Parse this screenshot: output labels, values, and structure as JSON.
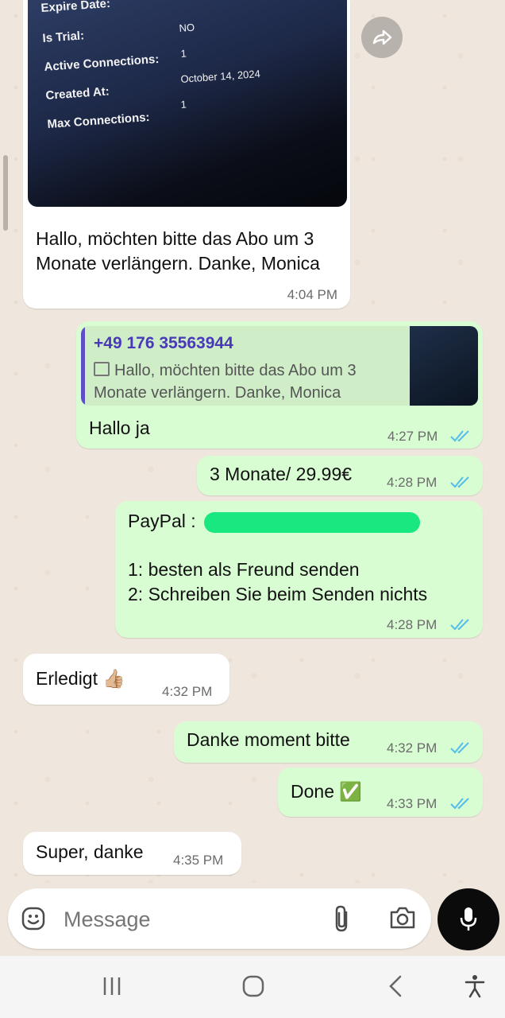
{
  "image_message": {
    "labels": [
      "Expire Date:",
      "Is Trial:",
      "Active Connections:",
      "Created At:",
      "Max Connections:"
    ],
    "values": [
      "NO",
      "1",
      "October 14, 2024",
      "1"
    ],
    "caption": "Hallo, möchten bitte das Abo um 3 Monate verlängern. Danke, Monica",
    "time": "4:04 PM"
  },
  "reply_message": {
    "quoted_sender": "+49 176 35563944",
    "quoted_text": "Hallo, möchten bitte das Abo um 3 Monate verlängern. Danke, Monica",
    "text": "Hallo ja",
    "time": "4:27 PM"
  },
  "msg_price": {
    "text": "3 Monate/ 29.99€",
    "time": "4:28 PM"
  },
  "msg_paypal": {
    "label": "PayPal :",
    "line1": "1:  besten als Freund senden",
    "line2": "2: Schreiben Sie beim Senden nichts",
    "time": "4:28 PM"
  },
  "msg_erledigt": {
    "text": "Erledigt 👍🏼",
    "time": "4:32 PM"
  },
  "msg_danke": {
    "text": "Danke moment bitte",
    "time": "4:32 PM"
  },
  "msg_done": {
    "text": "Done ✅",
    "time": "4:33 PM"
  },
  "msg_super": {
    "text": "Super, danke",
    "time": "4:35 PM"
  },
  "composer": {
    "placeholder": "Message"
  },
  "colors": {
    "outgoing": "#d9fdd3",
    "incoming": "#ffffff",
    "ticks": "#53bdeb",
    "background": "#efe7dd"
  },
  "icons": [
    "forward-icon",
    "emoji-icon",
    "attach-icon",
    "camera-icon",
    "mic-icon",
    "recents-icon",
    "home-icon",
    "back-icon",
    "accessibility-icon",
    "read-ticks-icon"
  ]
}
